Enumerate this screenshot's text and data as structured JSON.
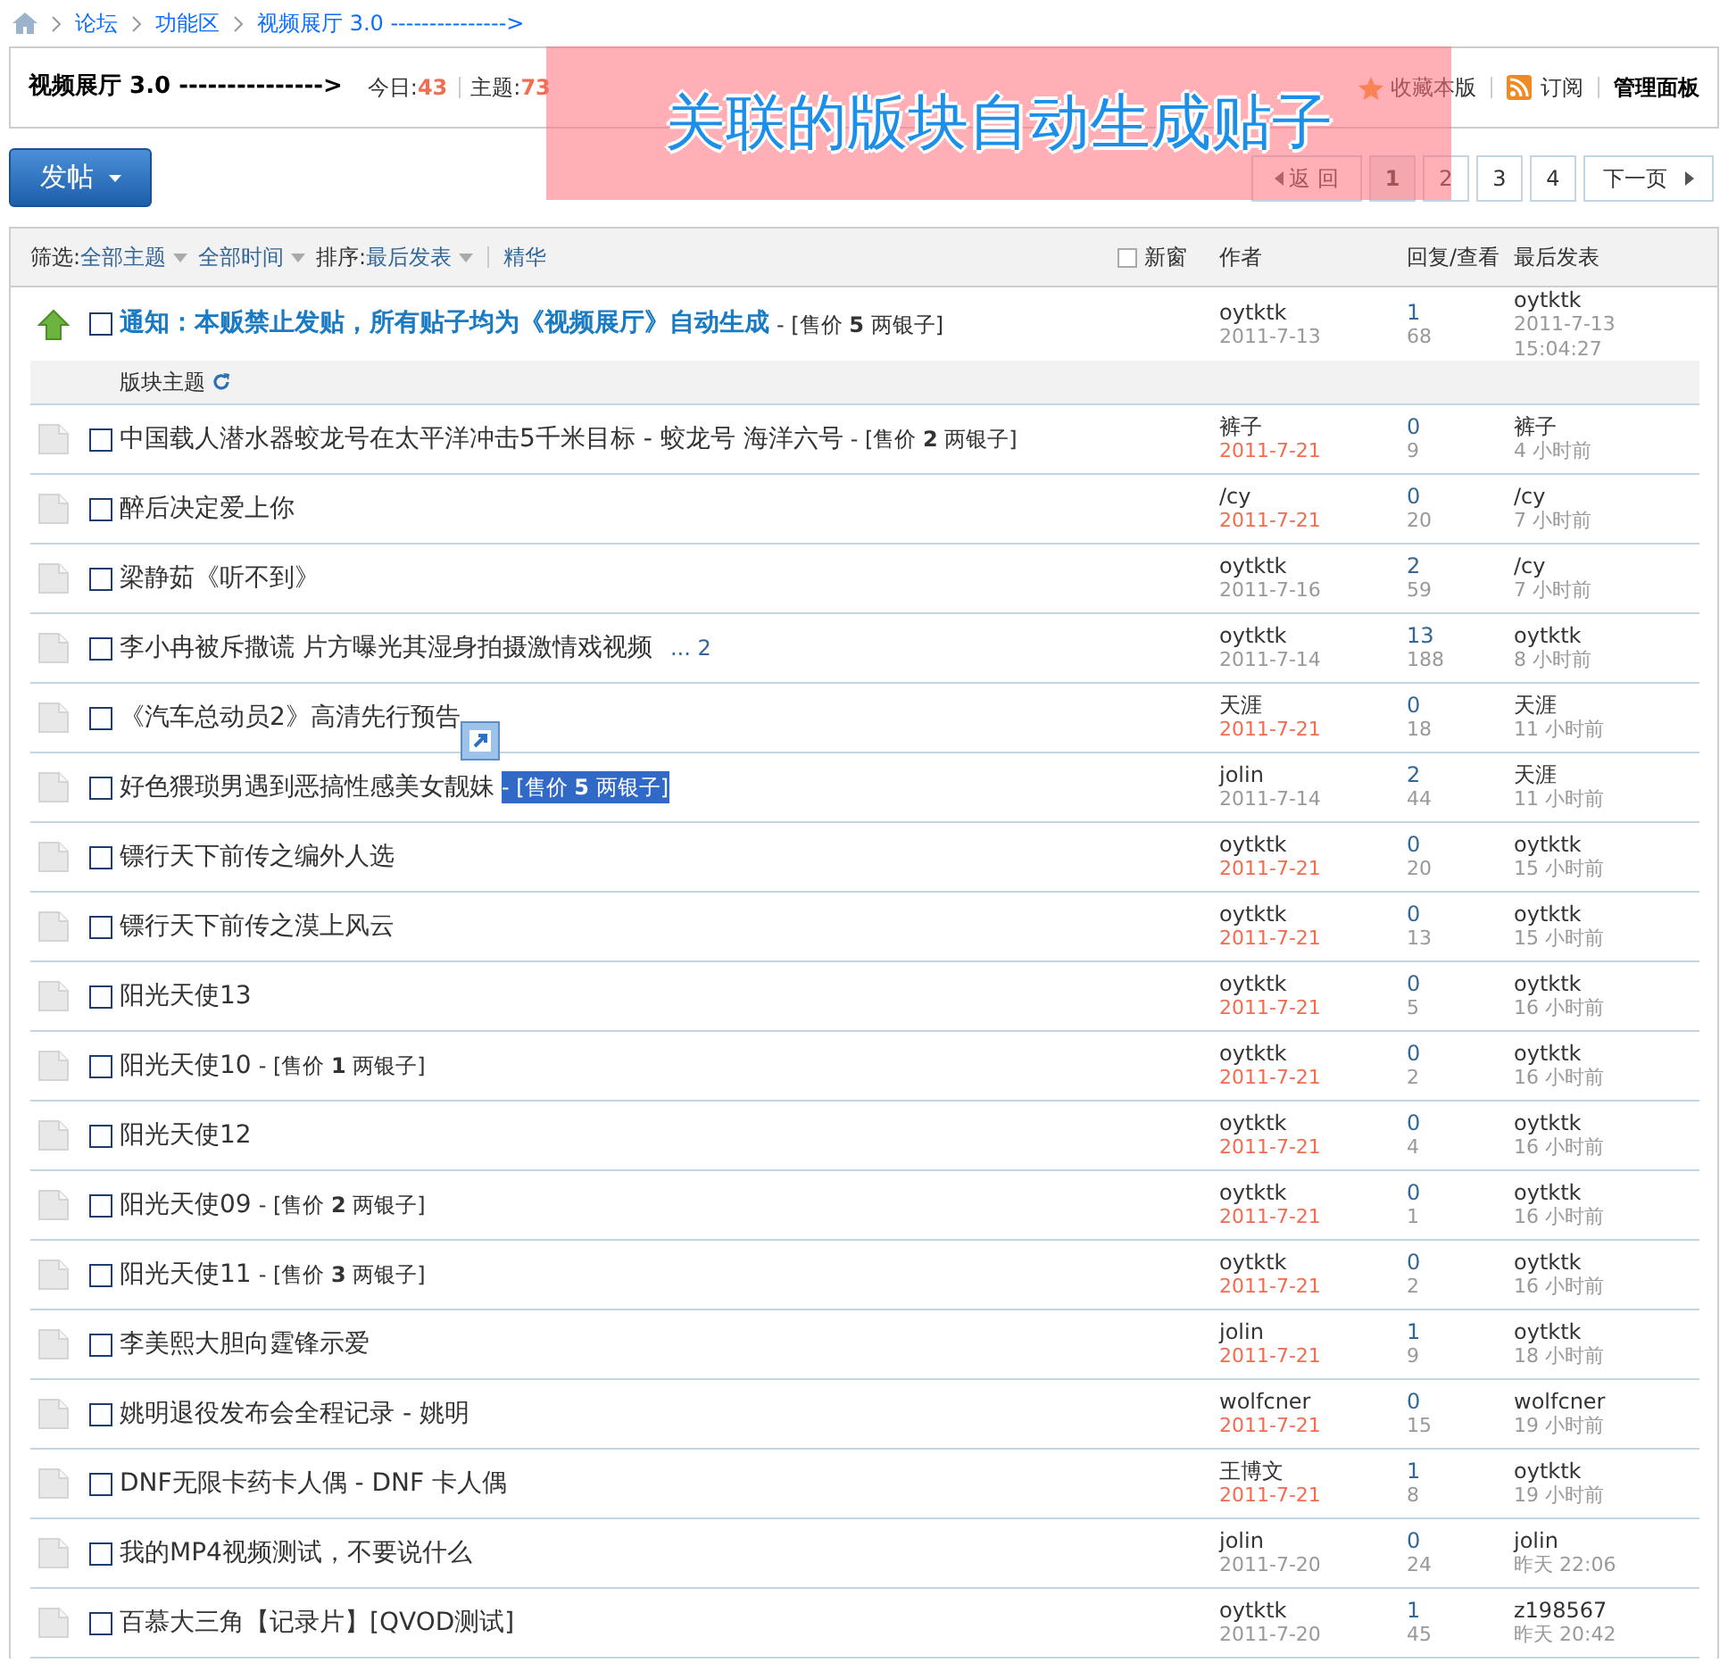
{
  "breadcrumb": [
    "论坛",
    "功能区",
    "视频展厅 3.0 --------------->"
  ],
  "forum_header": {
    "title": "视频展厅 3.0 --------------->",
    "stats": [
      {
        "label": "今日:",
        "value": "43"
      },
      {
        "label": "主题:",
        "value": "73"
      }
    ],
    "actions": [
      {
        "kind": "favorite",
        "label": "收藏本版"
      },
      {
        "kind": "rss",
        "label": "订阅"
      },
      {
        "kind": "admin",
        "label": "管理面板"
      }
    ]
  },
  "annotation": "关联的版块自动生成贴子",
  "post_button": "发帖",
  "pagination": {
    "back": "返 回",
    "pages": [
      {
        "label": "1",
        "selected": true
      },
      {
        "label": "2",
        "selected": false
      },
      {
        "label": "3",
        "selected": false
      },
      {
        "label": "4",
        "selected": false
      }
    ],
    "next": "下一页"
  },
  "filter_bar": {
    "items": [
      {
        "kind": "label",
        "text": "筛选:"
      },
      {
        "kind": "dropdown",
        "text": "全部主题"
      },
      {
        "kind": "dropdown",
        "text": "全部时间"
      },
      {
        "kind": "label",
        "text": "排序:"
      },
      {
        "kind": "dropdown",
        "text": "最后发表"
      },
      {
        "kind": "divider-link",
        "text": "精华"
      }
    ],
    "new_window": {
      "label": "新窗",
      "checked": false
    },
    "columns": [
      "作者",
      "回复/查看",
      "最后发表"
    ]
  },
  "sticky": [
    {
      "title": "通知：本贩禁止发贴，所有贴子均为《视频展厅》自动生成",
      "price": "- [售价 **5** 两银子]",
      "checked": false,
      "author": "oytktk",
      "date": "2011-7-13",
      "new": false,
      "replies": "1",
      "views": "68",
      "last_user": "oytktk",
      "last_time": "2011-7-13 15:04:27"
    }
  ],
  "section_label": "版块主题",
  "threads": [
    {
      "title": "中国载人潜水器蛟龙号在太平洋冲击5千米目标 - 蛟龙号 海洋六号",
      "price": "- [售价 **2** 两银子]",
      "highlighted": false,
      "checked": false,
      "author": "裤子",
      "date": "2011-7-21",
      "new": true,
      "replies": "0",
      "views": "9",
      "last_user": "裤子",
      "last_time": "4 小时前"
    },
    {
      "title": "醉后决定爱上你",
      "highlighted": false,
      "checked": false,
      "author": "/cy",
      "date": "2011-7-21",
      "new": true,
      "replies": "0",
      "views": "20",
      "last_user": "/cy",
      "last_time": "7 小时前"
    },
    {
      "title": "梁静茹《听不到》",
      "highlighted": false,
      "checked": false,
      "author": "oytktk",
      "date": "2011-7-16",
      "new": false,
      "replies": "2",
      "views": "59",
      "last_user": "/cy",
      "last_time": "7 小时前"
    },
    {
      "title": "李小冉被斥撒谎 片方曝光其湿身拍摄激情戏视频",
      "pages": "... 2",
      "highlighted": false,
      "checked": false,
      "author": "oytktk",
      "date": "2011-7-14",
      "new": false,
      "replies": "13",
      "views": "188",
      "last_user": "oytktk",
      "last_time": "8 小时前"
    },
    {
      "title": "《汽车总动员2》高清先行预告",
      "highlighted": false,
      "checked": false,
      "author": "天涯",
      "date": "2011-7-21",
      "new": true,
      "replies": "0",
      "views": "18",
      "last_user": "天涯",
      "last_time": "11 小时前"
    },
    {
      "title": "好色猥琐男遇到恶搞性感美女靓妹",
      "price": "- [售价 **5** 两银子]",
      "highlighted": true,
      "checked": false,
      "author": "jolin",
      "date": "2011-7-14",
      "new": false,
      "replies": "2",
      "views": "44",
      "last_user": "天涯",
      "last_time": "11 小时前"
    },
    {
      "title": "镖行天下前传之编外人选",
      "highlighted": false,
      "checked": false,
      "author": "oytktk",
      "date": "2011-7-21",
      "new": true,
      "replies": "0",
      "views": "20",
      "last_user": "oytktk",
      "last_time": "15 小时前"
    },
    {
      "title": "镖行天下前传之漠上风云",
      "highlighted": false,
      "checked": false,
      "author": "oytktk",
      "date": "2011-7-21",
      "new": true,
      "replies": "0",
      "views": "13",
      "last_user": "oytktk",
      "last_time": "15 小时前"
    },
    {
      "title": "阳光天使13",
      "highlighted": false,
      "checked": false,
      "author": "oytktk",
      "date": "2011-7-21",
      "new": true,
      "replies": "0",
      "views": "5",
      "last_user": "oytktk",
      "last_time": "16 小时前"
    },
    {
      "title": "阳光天使10",
      "price": "- [售价 **1** 两银子]",
      "highlighted": false,
      "checked": false,
      "author": "oytktk",
      "date": "2011-7-21",
      "new": true,
      "replies": "0",
      "views": "2",
      "last_user": "oytktk",
      "last_time": "16 小时前"
    },
    {
      "title": "阳光天使12",
      "highlighted": false,
      "checked": false,
      "author": "oytktk",
      "date": "2011-7-21",
      "new": true,
      "replies": "0",
      "views": "4",
      "last_user": "oytktk",
      "last_time": "16 小时前"
    },
    {
      "title": "阳光天使09",
      "price": "- [售价 **2** 两银子]",
      "highlighted": false,
      "checked": false,
      "author": "oytktk",
      "date": "2011-7-21",
      "new": true,
      "replies": "0",
      "views": "1",
      "last_user": "oytktk",
      "last_time": "16 小时前"
    },
    {
      "title": "阳光天使11",
      "price": "- [售价 **3** 两银子]",
      "highlighted": false,
      "checked": false,
      "author": "oytktk",
      "date": "2011-7-21",
      "new": true,
      "replies": "0",
      "views": "2",
      "last_user": "oytktk",
      "last_time": "16 小时前"
    },
    {
      "title": "李美熙大胆向霆锋示爱",
      "highlighted": false,
      "checked": false,
      "author": "jolin",
      "date": "2011-7-21",
      "new": true,
      "replies": "1",
      "views": "9",
      "last_user": "oytktk",
      "last_time": "18 小时前"
    },
    {
      "title": "姚明退役发布会全程记录 - 姚明",
      "highlighted": false,
      "checked": false,
      "author": "wolfcner",
      "date": "2011-7-21",
      "new": true,
      "replies": "0",
      "views": "15",
      "last_user": "wolfcner",
      "last_time": "19 小时前"
    },
    {
      "title": "DNF无限卡药卡人偶 - DNF 卡人偶",
      "highlighted": false,
      "checked": false,
      "author": "王博文",
      "date": "2011-7-21",
      "new": true,
      "replies": "1",
      "views": "8",
      "last_user": "oytktk",
      "last_time": "19 小时前"
    },
    {
      "title": "我的MP4视频测试，不要说什么",
      "highlighted": false,
      "checked": false,
      "author": "jolin",
      "date": "2011-7-20",
      "new": false,
      "replies": "0",
      "views": "24",
      "last_user": "jolin",
      "last_time": "昨天 22:06"
    },
    {
      "title": "百慕大三角【记录片】[QVOD测试]",
      "highlighted": false,
      "checked": false,
      "author": "oytktk",
      "date": "2011-7-20",
      "new": false,
      "replies": "1",
      "views": "45",
      "last_user": "z198567",
      "last_time": "昨天 20:42"
    }
  ]
}
